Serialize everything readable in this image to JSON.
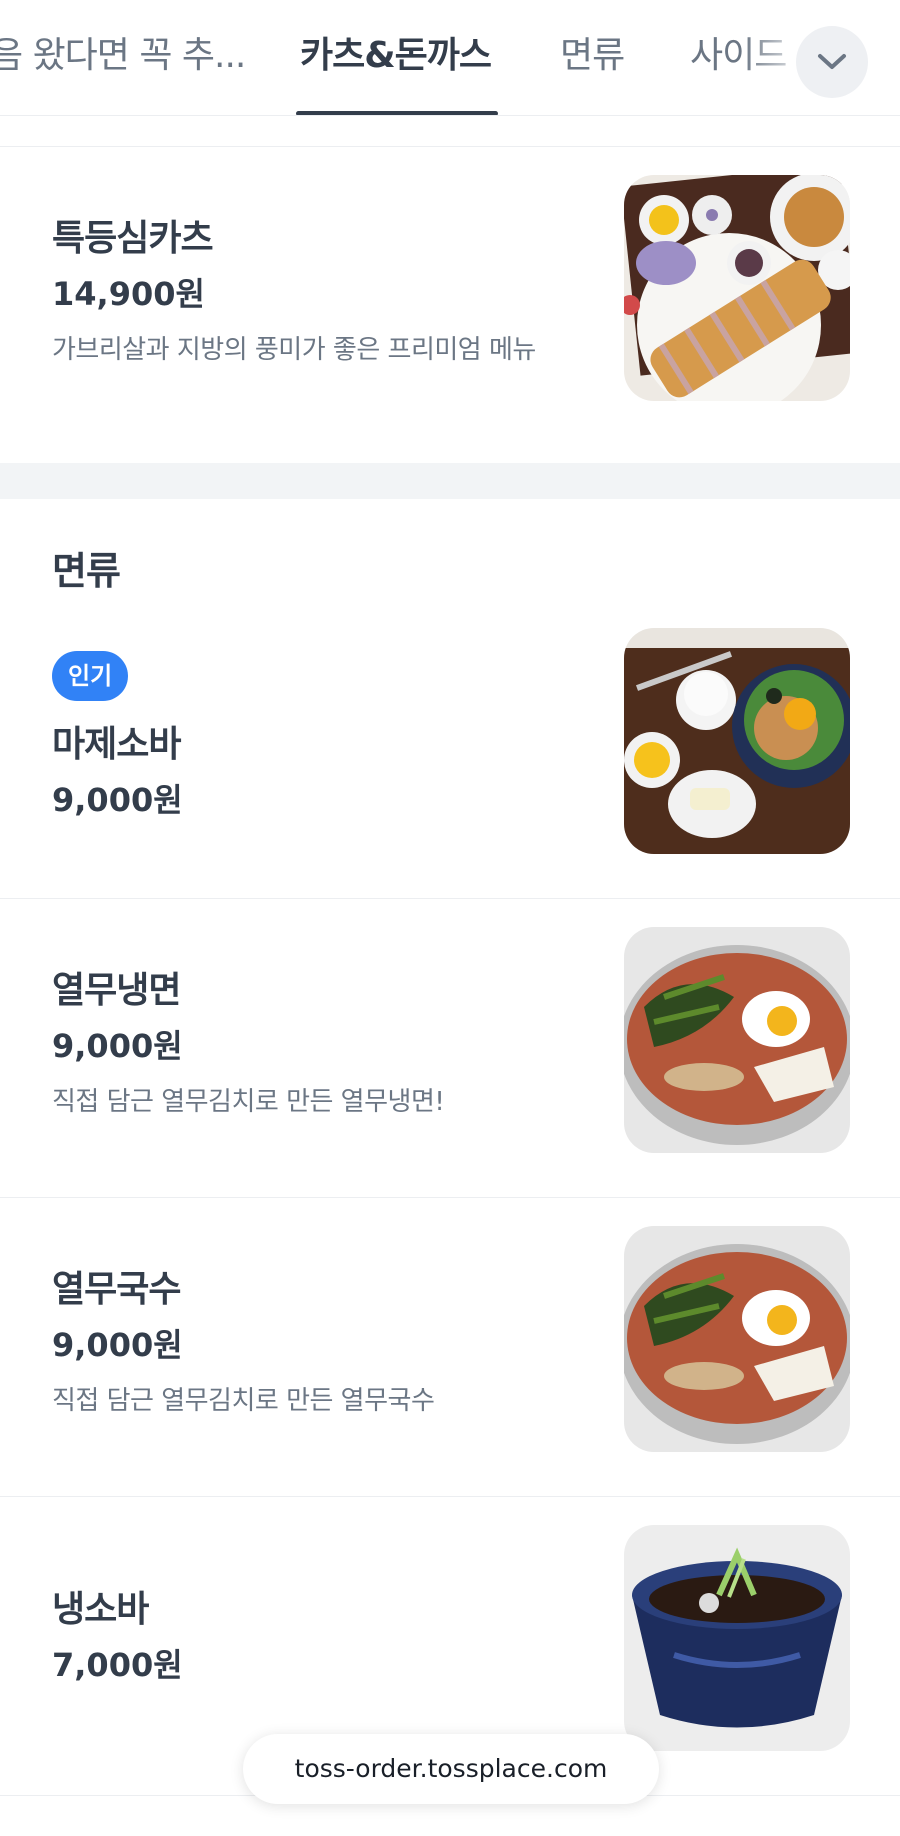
{
  "tabs": [
    {
      "label": "음 왔다면 꼭 추..."
    },
    {
      "label": "카츠&돈까스"
    },
    {
      "label": "면류"
    },
    {
      "label": "사이드"
    }
  ],
  "active_tab_index": 1,
  "icons": {
    "dropdown": "chevron-down-icon"
  },
  "colors": {
    "accent": "#3182f6",
    "text_primary": "#333d4b",
    "text_secondary": "#6b7684",
    "section_gap": "#f2f4f6"
  },
  "sections": [
    {
      "title": "",
      "items": [
        {
          "name": "특등심카츠",
          "price": "14,900원",
          "description": "가브리살과 지방의 풍미가 좋은 프리미엄 메뉴",
          "photo": "tonkatsu-set-photo"
        }
      ]
    },
    {
      "title": "면류",
      "items": [
        {
          "badge": "인기",
          "name": "마제소바",
          "price": "9,000원",
          "photo": "mazesoba-set-photo"
        },
        {
          "name": "열무냉면",
          "price": "9,000원",
          "description": "직접 담근 열무김치로 만든 열무냉면!",
          "photo": "yeolmu-naengmyeon-photo"
        },
        {
          "name": "열무국수",
          "price": "9,000원",
          "description": "직접 담근 열무김치로 만든 열무국수",
          "photo": "yeolmu-guksu-photo"
        },
        {
          "name": "냉소바",
          "price": "7,000원",
          "photo": "cold-soba-photo"
        }
      ]
    }
  ],
  "url_bar": {
    "text": "toss-order.tossplace.com"
  }
}
